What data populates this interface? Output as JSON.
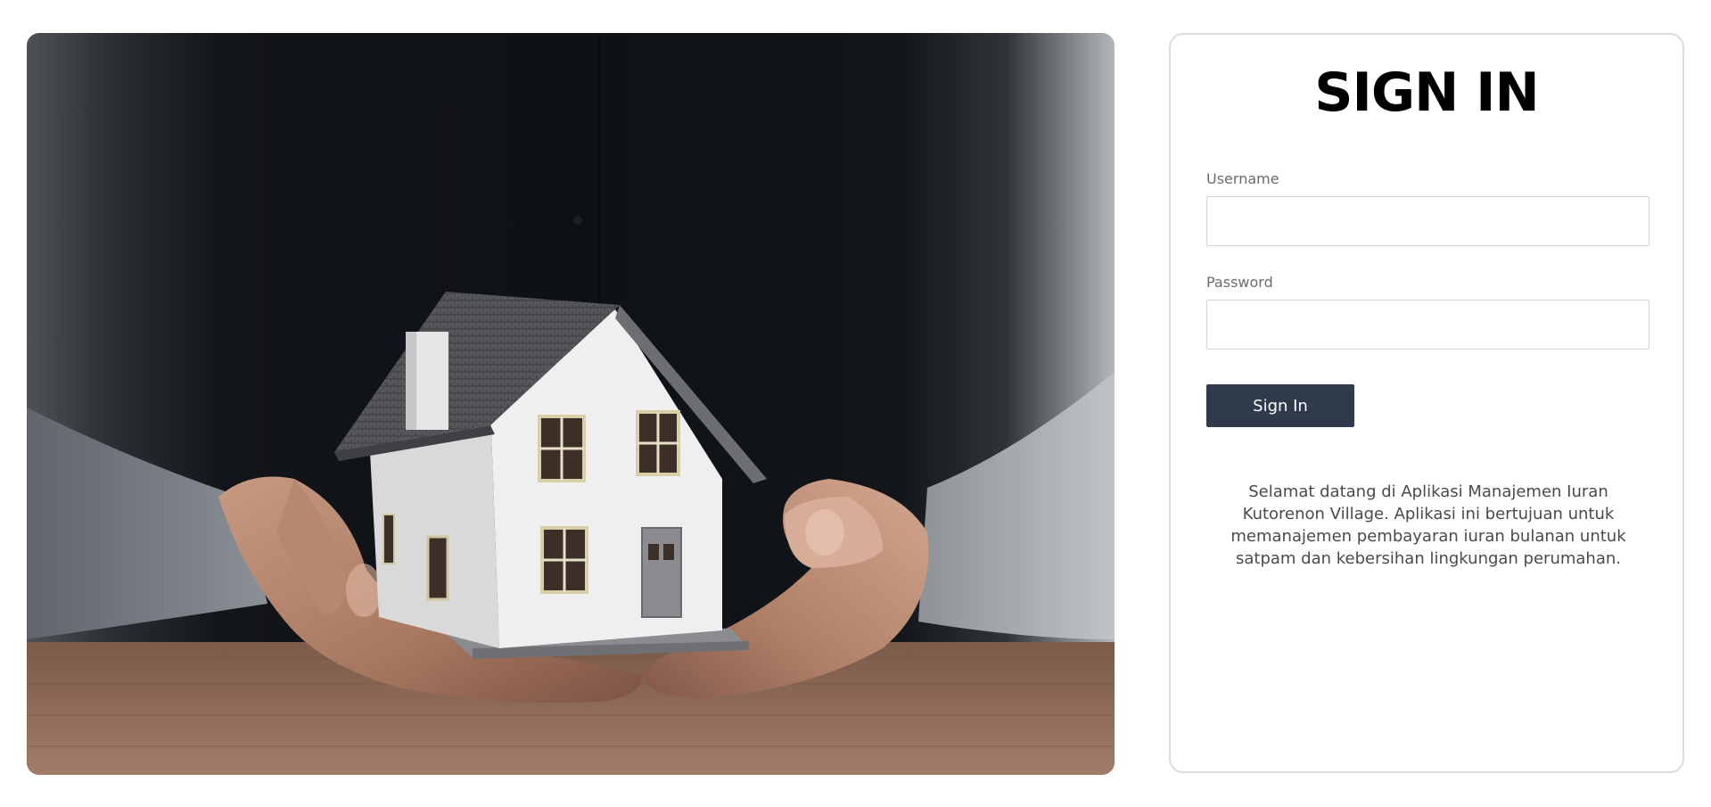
{
  "signin": {
    "title": "SIGN IN",
    "username_label": "Username",
    "username_value": "",
    "password_label": "Password",
    "password_value": "",
    "button_label": "Sign In",
    "description": "Selamat datang di Aplikasi Manajemen Iuran Kutorenon Village. Aplikasi ini bertujuan untuk memanajemen pembayaran iuran bulanan untuk satpam dan kebersihan lingkungan perumahan."
  },
  "colors": {
    "button_bg": "#2f3b4d",
    "card_border": "#dcdcdc",
    "title": "#000000"
  }
}
